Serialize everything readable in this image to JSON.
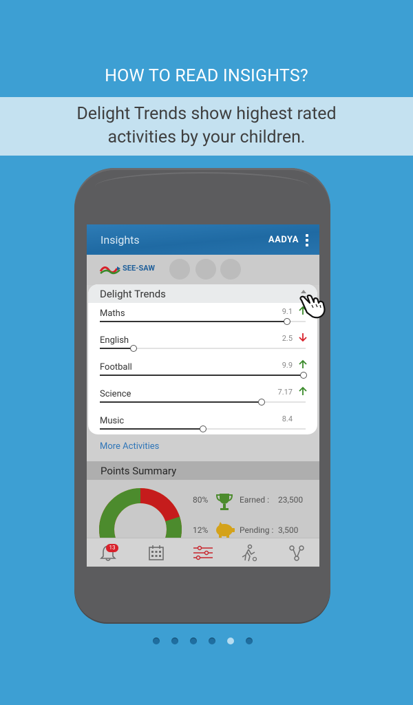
{
  "intro": {
    "heading": "HOW TO READ INSIGHTS?",
    "line1": "Delight Trends show highest rated",
    "line2": "activities by your children."
  },
  "app": {
    "title": "Insights",
    "brand": "AADYA",
    "child_app": "SEE-SAW"
  },
  "delight": {
    "title": "Delight Trends",
    "rows": [
      {
        "label": "Maths",
        "value": "9.1",
        "level": 0.91,
        "trend": "up"
      },
      {
        "label": "English",
        "value": "2.5",
        "level": 0.165,
        "trend": "down"
      },
      {
        "label": "Football",
        "value": "9.9",
        "level": 0.99,
        "trend": "up"
      },
      {
        "label": "Science",
        "value": "7.17",
        "level": 0.787,
        "trend": "up"
      },
      {
        "label": "Music",
        "value": "8.4",
        "level": 0.5,
        "trend": "none"
      }
    ],
    "more": "More  Activities"
  },
  "points": {
    "title": "Points Summary",
    "earned_pct": "80%",
    "earned_label": "Earned :",
    "earned_value": "23,500",
    "pending_pct": "12%",
    "pending_label": "Pending :",
    "pending_value": "3,500"
  },
  "nav": {
    "notification_count": "13"
  },
  "colors": {
    "background": "#3d9fd3",
    "appbar": "#1f6aa3",
    "up_arrow": "#3a8a2a",
    "down_arrow": "#d8202a",
    "donut_green": "#4c8b2d",
    "donut_red": "#c51c1c",
    "donut_yellow": "#d4a21a"
  },
  "pager": {
    "count": 6,
    "active": 5
  }
}
